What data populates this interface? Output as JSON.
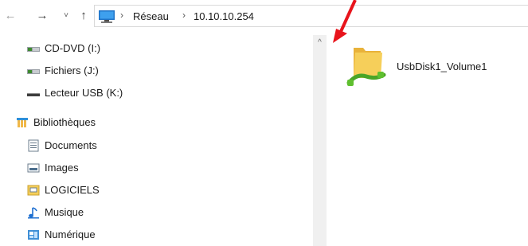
{
  "address_bar": {
    "crumbs": [
      "Réseau",
      "10.10.10.254"
    ]
  },
  "nav": {
    "back_glyph": "←",
    "forward_glyph": "→",
    "recent_glyph": "˅",
    "up_glyph": "↑",
    "separator": "›"
  },
  "tree": {
    "drives": [
      {
        "label": "CD-DVD (I:)",
        "icon": "network-drive-icon"
      },
      {
        "label": "Fichiers (J:)",
        "icon": "network-drive-icon"
      },
      {
        "label": "Lecteur USB (K:)",
        "icon": "usb-drive-icon"
      }
    ],
    "libraries_label": "Bibliothèques",
    "libraries": [
      {
        "label": "Documents",
        "icon": "documents-icon"
      },
      {
        "label": "Images",
        "icon": "images-icon"
      },
      {
        "label": "LOGICIELS",
        "icon": "library-folder-icon"
      },
      {
        "label": "Musique",
        "icon": "music-icon"
      },
      {
        "label": "Numérique",
        "icon": "numerique-icon"
      }
    ]
  },
  "scroll": {
    "up_glyph": "^"
  },
  "content": {
    "items": [
      {
        "label": "UsbDisk1_Volume1",
        "icon": "network-share-folder-icon"
      }
    ]
  },
  "colors": {
    "annotation_arrow": "#e8141c",
    "folder": "#f3c94a",
    "network_green": "#5fbf2f"
  }
}
